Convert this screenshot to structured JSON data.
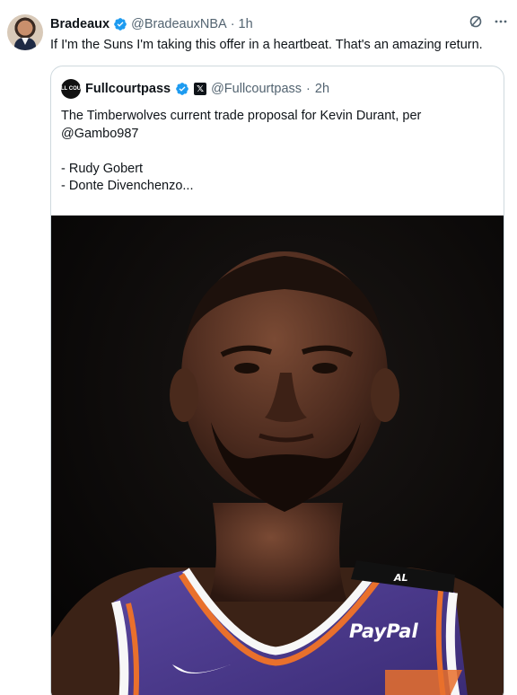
{
  "tweet": {
    "name": "Bradeaux",
    "handle": "@BradeauxNBA",
    "separator": "·",
    "time": "1h",
    "text": "If I'm the Suns I'm taking this offer in a heartbeat. That's an amazing return.",
    "avatar_icon": "user-avatar",
    "more_icon": "more-horizontal-icon",
    "grok_icon": "slash-circle-icon"
  },
  "quote": {
    "avatar_text": "FULL COURT",
    "name": "Fullcourtpass",
    "handle": "@Fullcourtpass",
    "separator": "·",
    "time": "2h",
    "lines": [
      "The Timberwolves current trade proposal for Kevin Durant, per",
      "@Gambo987",
      "",
      "- Rudy Gobert",
      "- Donte Divenchenzo..."
    ],
    "photo": {
      "jersey_patch": "AL",
      "sponsor": "PayPal",
      "jersey_color": "#4c3a8c",
      "trim_color": "#e9702c"
    }
  },
  "colors": {
    "verified": "#1d9bf0",
    "secondary_text": "#536471",
    "border": "#cfd9de"
  }
}
